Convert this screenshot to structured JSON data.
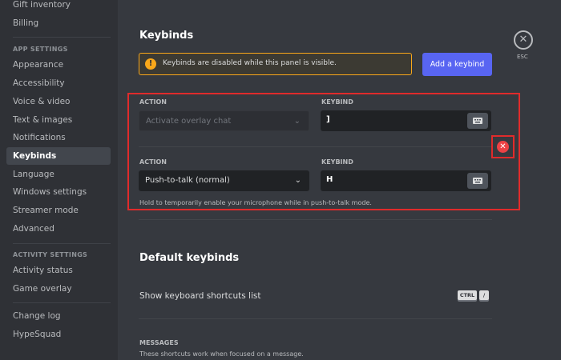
{
  "sidebar": {
    "top_items": [
      {
        "label": "Gift inventory"
      },
      {
        "label": "Billing"
      }
    ],
    "app_settings_header": "APP SETTINGS",
    "app_settings_items": [
      {
        "label": "Appearance"
      },
      {
        "label": "Accessibility"
      },
      {
        "label": "Voice & video"
      },
      {
        "label": "Text & images"
      },
      {
        "label": "Notifications"
      },
      {
        "label": "Keybinds",
        "active": true
      },
      {
        "label": "Language"
      },
      {
        "label": "Windows settings"
      },
      {
        "label": "Streamer mode"
      },
      {
        "label": "Advanced"
      }
    ],
    "activity_settings_header": "ACTIVITY SETTINGS",
    "activity_items": [
      {
        "label": "Activity status"
      },
      {
        "label": "Game overlay"
      }
    ],
    "bottom_items": [
      {
        "label": "Change log"
      },
      {
        "label": "HypeSquad"
      }
    ]
  },
  "page": {
    "title": "Keybinds",
    "notice": "Keybinds are disabled while this panel is visible.",
    "notice_icon": "!",
    "add_button": "Add a keybind",
    "close_icon": "✕",
    "esc_label": "ESC"
  },
  "keybinds": [
    {
      "action_label": "ACTION",
      "action_value": "Activate overlay chat",
      "action_disabled": true,
      "keybind_label": "KEYBIND",
      "keybind_value": "]"
    },
    {
      "action_label": "ACTION",
      "action_value": "Push-to-talk (normal)",
      "action_disabled": false,
      "keybind_label": "KEYBIND",
      "keybind_value": "H",
      "hint": "Hold to temporarily enable your microphone while in push-to-talk mode."
    }
  ],
  "remove_icon": "✕",
  "default_keybinds": {
    "title": "Default keybinds",
    "shortcuts_label": "Show keyboard shortcuts list",
    "shortcut_keys": [
      "CTRL",
      "/"
    ],
    "messages_header": "MESSAGES",
    "messages_desc": "These shortcuts work when focused on a message."
  },
  "colors": {
    "accent": "#5865f2",
    "warning": "#faa81a",
    "danger": "#ed4245",
    "highlight_border": "#e02b2b"
  }
}
